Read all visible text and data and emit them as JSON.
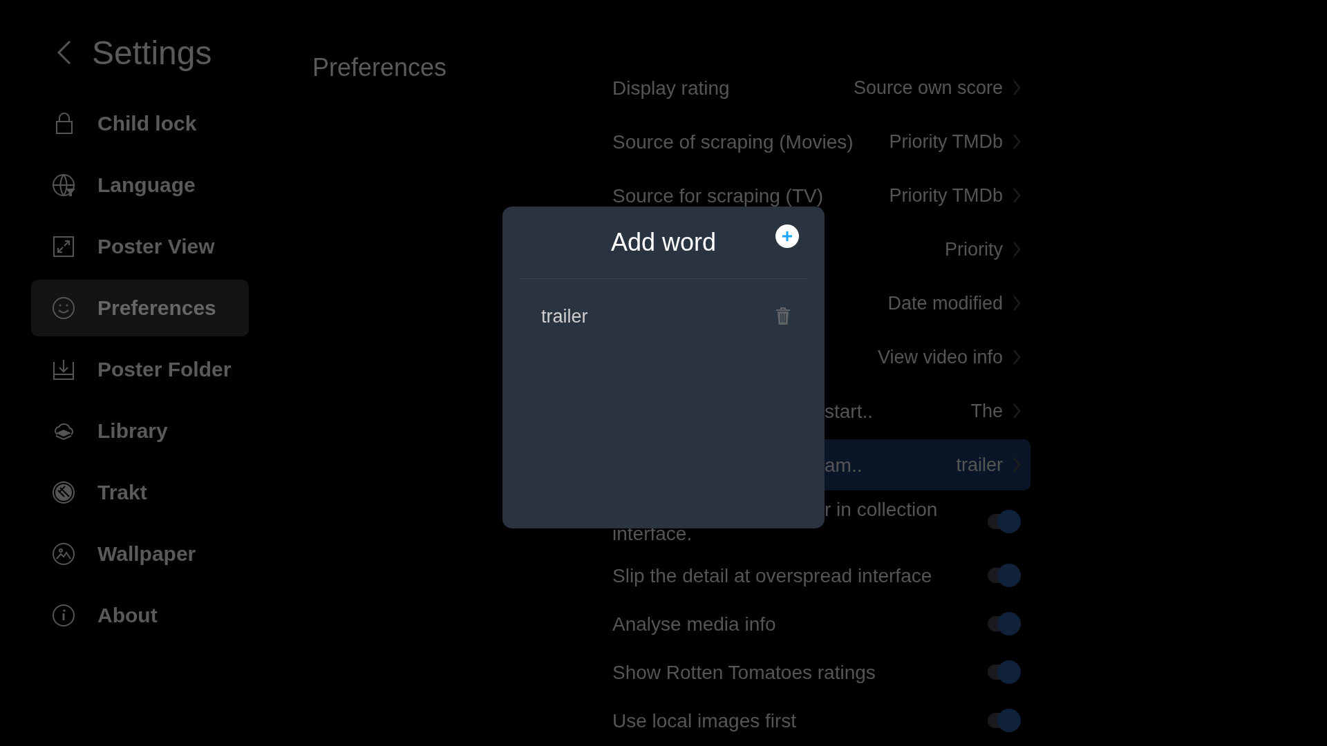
{
  "sidebar": {
    "title": "Settings",
    "items": [
      {
        "label": "Child lock",
        "selected": false
      },
      {
        "label": "Language",
        "selected": false
      },
      {
        "label": "Poster View",
        "selected": false
      },
      {
        "label": "Preferences",
        "selected": true
      },
      {
        "label": "Poster Folder",
        "selected": false
      },
      {
        "label": "Library",
        "selected": false
      },
      {
        "label": "Trakt",
        "selected": false
      },
      {
        "label": "Wallpaper",
        "selected": false
      },
      {
        "label": "About",
        "selected": false
      }
    ]
  },
  "section_title": "Preferences",
  "settings": [
    {
      "kind": "choice",
      "label": "Display rating",
      "value": "Source own score",
      "selected": false
    },
    {
      "kind": "choice",
      "label": "Source of scraping (Movies)",
      "value": "Priority TMDb",
      "selected": false
    },
    {
      "kind": "choice",
      "label": "Source for scraping (TV)",
      "value": "Priority TMDb",
      "selected": false
    },
    {
      "kind": "choice",
      "value": "Priority",
      "selected": false
    },
    {
      "kind": "choice",
      "value": "Date modified",
      "selected": false
    },
    {
      "kind": "choice",
      "value": "View video info",
      "selected": false
    },
    {
      "kind": "choice",
      "label": "start..",
      "value": "The",
      "selected": false,
      "covered": true
    },
    {
      "kind": "choice",
      "label": "am..",
      "value": "trailer",
      "selected": true,
      "covered": true
    },
    {
      "kind": "toggle",
      "label": "r in collection interface.",
      "on": true,
      "covered": true
    },
    {
      "kind": "toggle",
      "label": "Slip the detail at overspread interface",
      "on": true
    },
    {
      "kind": "toggle",
      "label": "Analyse media info",
      "on": true
    },
    {
      "kind": "toggle",
      "label": "Show Rotten Tomatoes ratings",
      "on": true
    },
    {
      "kind": "toggle",
      "label": "Use local images first",
      "on": true
    }
  ],
  "dialog": {
    "title": "Add word",
    "words": [
      {
        "text": "trailer"
      }
    ]
  }
}
